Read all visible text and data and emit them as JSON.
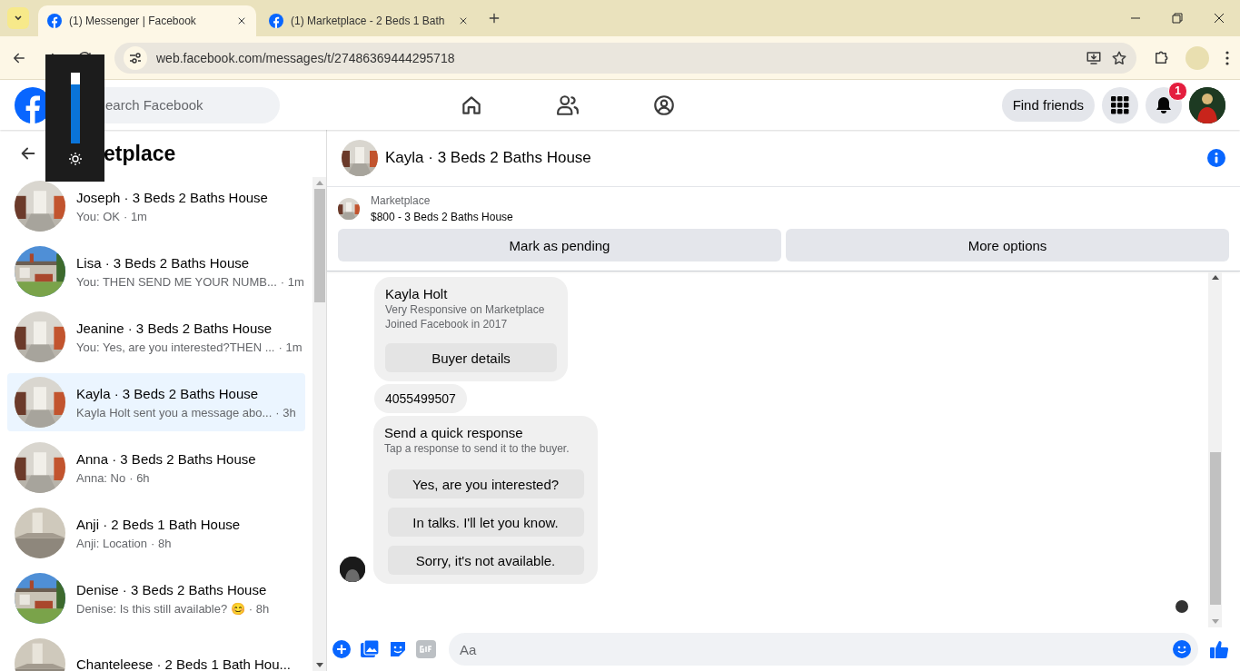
{
  "browser": {
    "tabs": [
      {
        "title": "(1) Messenger | Facebook",
        "selected": true
      },
      {
        "title": "(1) Marketplace - 2 Beds 1 Bath",
        "selected": false
      }
    ],
    "url": "web.facebook.com/messages/t/27486369444295718"
  },
  "brightness_overlay": {
    "level": 0.83
  },
  "topbar": {
    "search": {
      "placeholder": "earch Facebook"
    },
    "find_friends": "Find friends",
    "notification_count": "1"
  },
  "sidebar": {
    "title": "etplace",
    "conversations": [
      {
        "title": "Joseph · 3 Beds 2 Baths House",
        "preview": "You: OK",
        "time": "· 1m",
        "selected": false
      },
      {
        "title": "Lisa · 3 Beds 2 Baths House",
        "preview": "You: THEN SEND ME YOUR NUMB...",
        "time": "· 1m",
        "selected": false
      },
      {
        "title": "Jeanine · 3 Beds 2 Baths House",
        "preview": "You: Yes, are you interested?THEN ...",
        "time": "· 1m",
        "selected": false
      },
      {
        "title": "Kayla · 3 Beds 2 Baths House",
        "preview": "Kayla Holt sent you a message abo...",
        "time": "· 3h",
        "selected": true
      },
      {
        "title": "Anna · 3 Beds 2 Baths House",
        "preview": "Anna: No",
        "time": "· 6h",
        "selected": false
      },
      {
        "title": "Anji · 2 Beds 1 Bath House",
        "preview": "Anji: Location",
        "time": "· 8h",
        "selected": false
      },
      {
        "title": "Denise · 3 Beds 2 Baths House",
        "preview": "Denise: Is this still available? 😊",
        "time": "· 8h",
        "selected": false
      },
      {
        "title": "Chanteleese · 2 Beds 1 Bath Hou...",
        "selected": false
      }
    ]
  },
  "chat": {
    "title": "Kayla · 3 Beds 2 Baths House",
    "listing": {
      "label": "Marketplace",
      "title": "$800 - 3 Beds 2 Baths House",
      "actions": [
        "Mark as pending",
        "More options"
      ]
    },
    "messages": [
      {
        "kind": "buyer_card",
        "name": "Kayla Holt",
        "lines": [
          "Very Responsive on Marketplace",
          "Joined Facebook in 2017"
        ],
        "button": "Buyer details"
      },
      {
        "kind": "text",
        "text": "4055499507"
      },
      {
        "kind": "quick_responses",
        "title": "Send a quick response",
        "subtitle": "Tap a response to send it to the buyer.",
        "options": [
          "Yes, are you interested?",
          "In talks. I'll let you know.",
          "Sorry, it's not available."
        ]
      }
    ],
    "composer": {
      "placeholder": "Aa"
    }
  }
}
